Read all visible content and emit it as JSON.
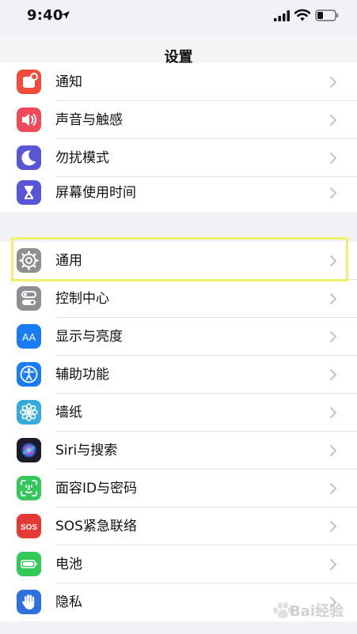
{
  "status_bar": {
    "time": "9:40"
  },
  "nav": {
    "title": "设置"
  },
  "group1": [
    {
      "label": "通知",
      "icon": "notifications-icon",
      "color": "#f04c3e"
    },
    {
      "label": "声音与触感",
      "icon": "sounds-icon",
      "color": "#ef4a5a"
    },
    {
      "label": "勿扰模式",
      "icon": "do-not-disturb-icon",
      "color": "#5856d6"
    },
    {
      "label": "屏幕使用时间",
      "icon": "screen-time-icon",
      "color": "#5856d6"
    }
  ],
  "group2": [
    {
      "label": "通用",
      "icon": "gear-icon",
      "color": "#8e8e93"
    },
    {
      "label": "控制中心",
      "icon": "control-center-icon",
      "color": "#8e8e93"
    },
    {
      "label": "显示与亮度",
      "icon": "display-brightness-icon",
      "color": "#1a7cf5"
    },
    {
      "label": "辅助功能",
      "icon": "accessibility-icon",
      "color": "#1a7cf5"
    },
    {
      "label": "墙纸",
      "icon": "wallpaper-icon",
      "color": "#36aadc"
    },
    {
      "label": "Siri与搜索",
      "icon": "siri-icon",
      "color": "#1b1b2b"
    },
    {
      "label": "面容ID与密码",
      "icon": "face-id-icon",
      "color": "#34c759"
    },
    {
      "label": "SOS紧急联络",
      "icon": "sos-icon",
      "color": "#e53935"
    },
    {
      "label": "电池",
      "icon": "battery-icon",
      "color": "#34c759"
    },
    {
      "label": "隐私",
      "icon": "privacy-hand-icon",
      "color": "#2f6fdf"
    }
  ],
  "icon_text": {
    "display": "AA",
    "sos": "SOS"
  },
  "watermark": {
    "text": "Bai经验"
  }
}
